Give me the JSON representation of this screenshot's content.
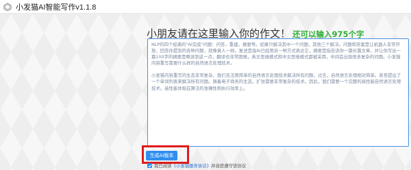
{
  "window": {
    "title": "小发猫AI智能写作v1.1.8"
  },
  "main": {
    "heading": "小朋友请在这里输入你的作文！",
    "char_limit_text": "还可以输入975个字",
    "editor": {
      "paragraph1": "NLP的四个经典的\"AI完成\"问题：问答，重建，摘要等。如果只解决其中一个问题，其他三个解决。问题和答案是让机器人非常开放，回答你提到的各种问题，就像真人一样。复述是指AI已经用另一种方式表达它，摘要是指告诉你一篇长篇文章，并让你写出一篇100字的摘要是略读到这一点，翻译也非常困难，英文思维模式和中文思维模式都被采用，中间会出现很多复杂的问题。小发猫内容重写需要什么样的自然语言处理技术。",
      "paragraph2": "小发猫内容重写的生态非常复杂。我们无法用简单的自然语言处理技术解决所有问题。过去，自然语言处理相对简单。甚至提出了一个单词列表来解决所有问题。随着电子商务的生态，扩张需要非常复杂的技术。因此，我们需要一个完整的高性能自然语言处理技术。高性能体现在算法的准确性和执行效率上。"
    },
    "generate_button": "生成AI版本",
    "agree": {
      "prefix": "我已阅读",
      "link": "《小发猫服务协议》",
      "suffix": "并自愿遵守该协议"
    }
  },
  "colors": {
    "accent": "#2f8ef0",
    "count_green": "#2eae36",
    "highlight_red": "#e01b1b"
  }
}
